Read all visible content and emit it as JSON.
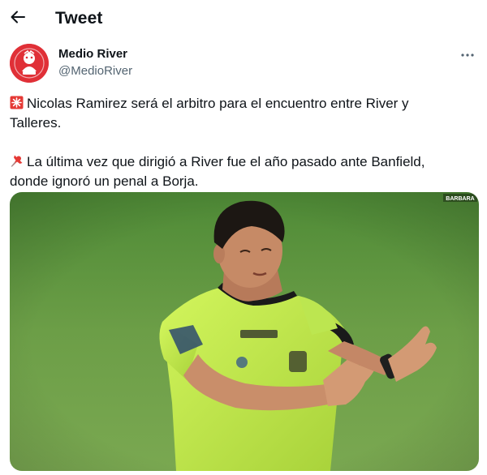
{
  "header": {
    "title": "Tweet",
    "back_icon": "arrow-left-icon"
  },
  "author": {
    "display_name": "Medio River",
    "handle": "@MedioRiver",
    "avatar_icon": "medio-river-logo",
    "more_icon": "more-horizontal-icon"
  },
  "tweet": {
    "paragraphs": [
      {
        "emoji": "police-light-icon",
        "lines": [
          "Nicolas Ramirez será el arbitro para el encuentro entre River y",
          "Talleres."
        ]
      },
      {
        "emoji": "pushpin-icon",
        "lines": [
          "La última vez que dirigió a River fue el año pasado ante Banfield,",
          "donde ignoró un penal a Borja."
        ]
      }
    ],
    "media": {
      "description_icon": "photo-referee-gesture",
      "watermark": "BARBARA"
    }
  },
  "colors": {
    "text": "#0f1419",
    "secondary": "#536471",
    "brand_red": "#e03037",
    "grass": "#6a9b45",
    "jersey": "#c6f04a"
  }
}
